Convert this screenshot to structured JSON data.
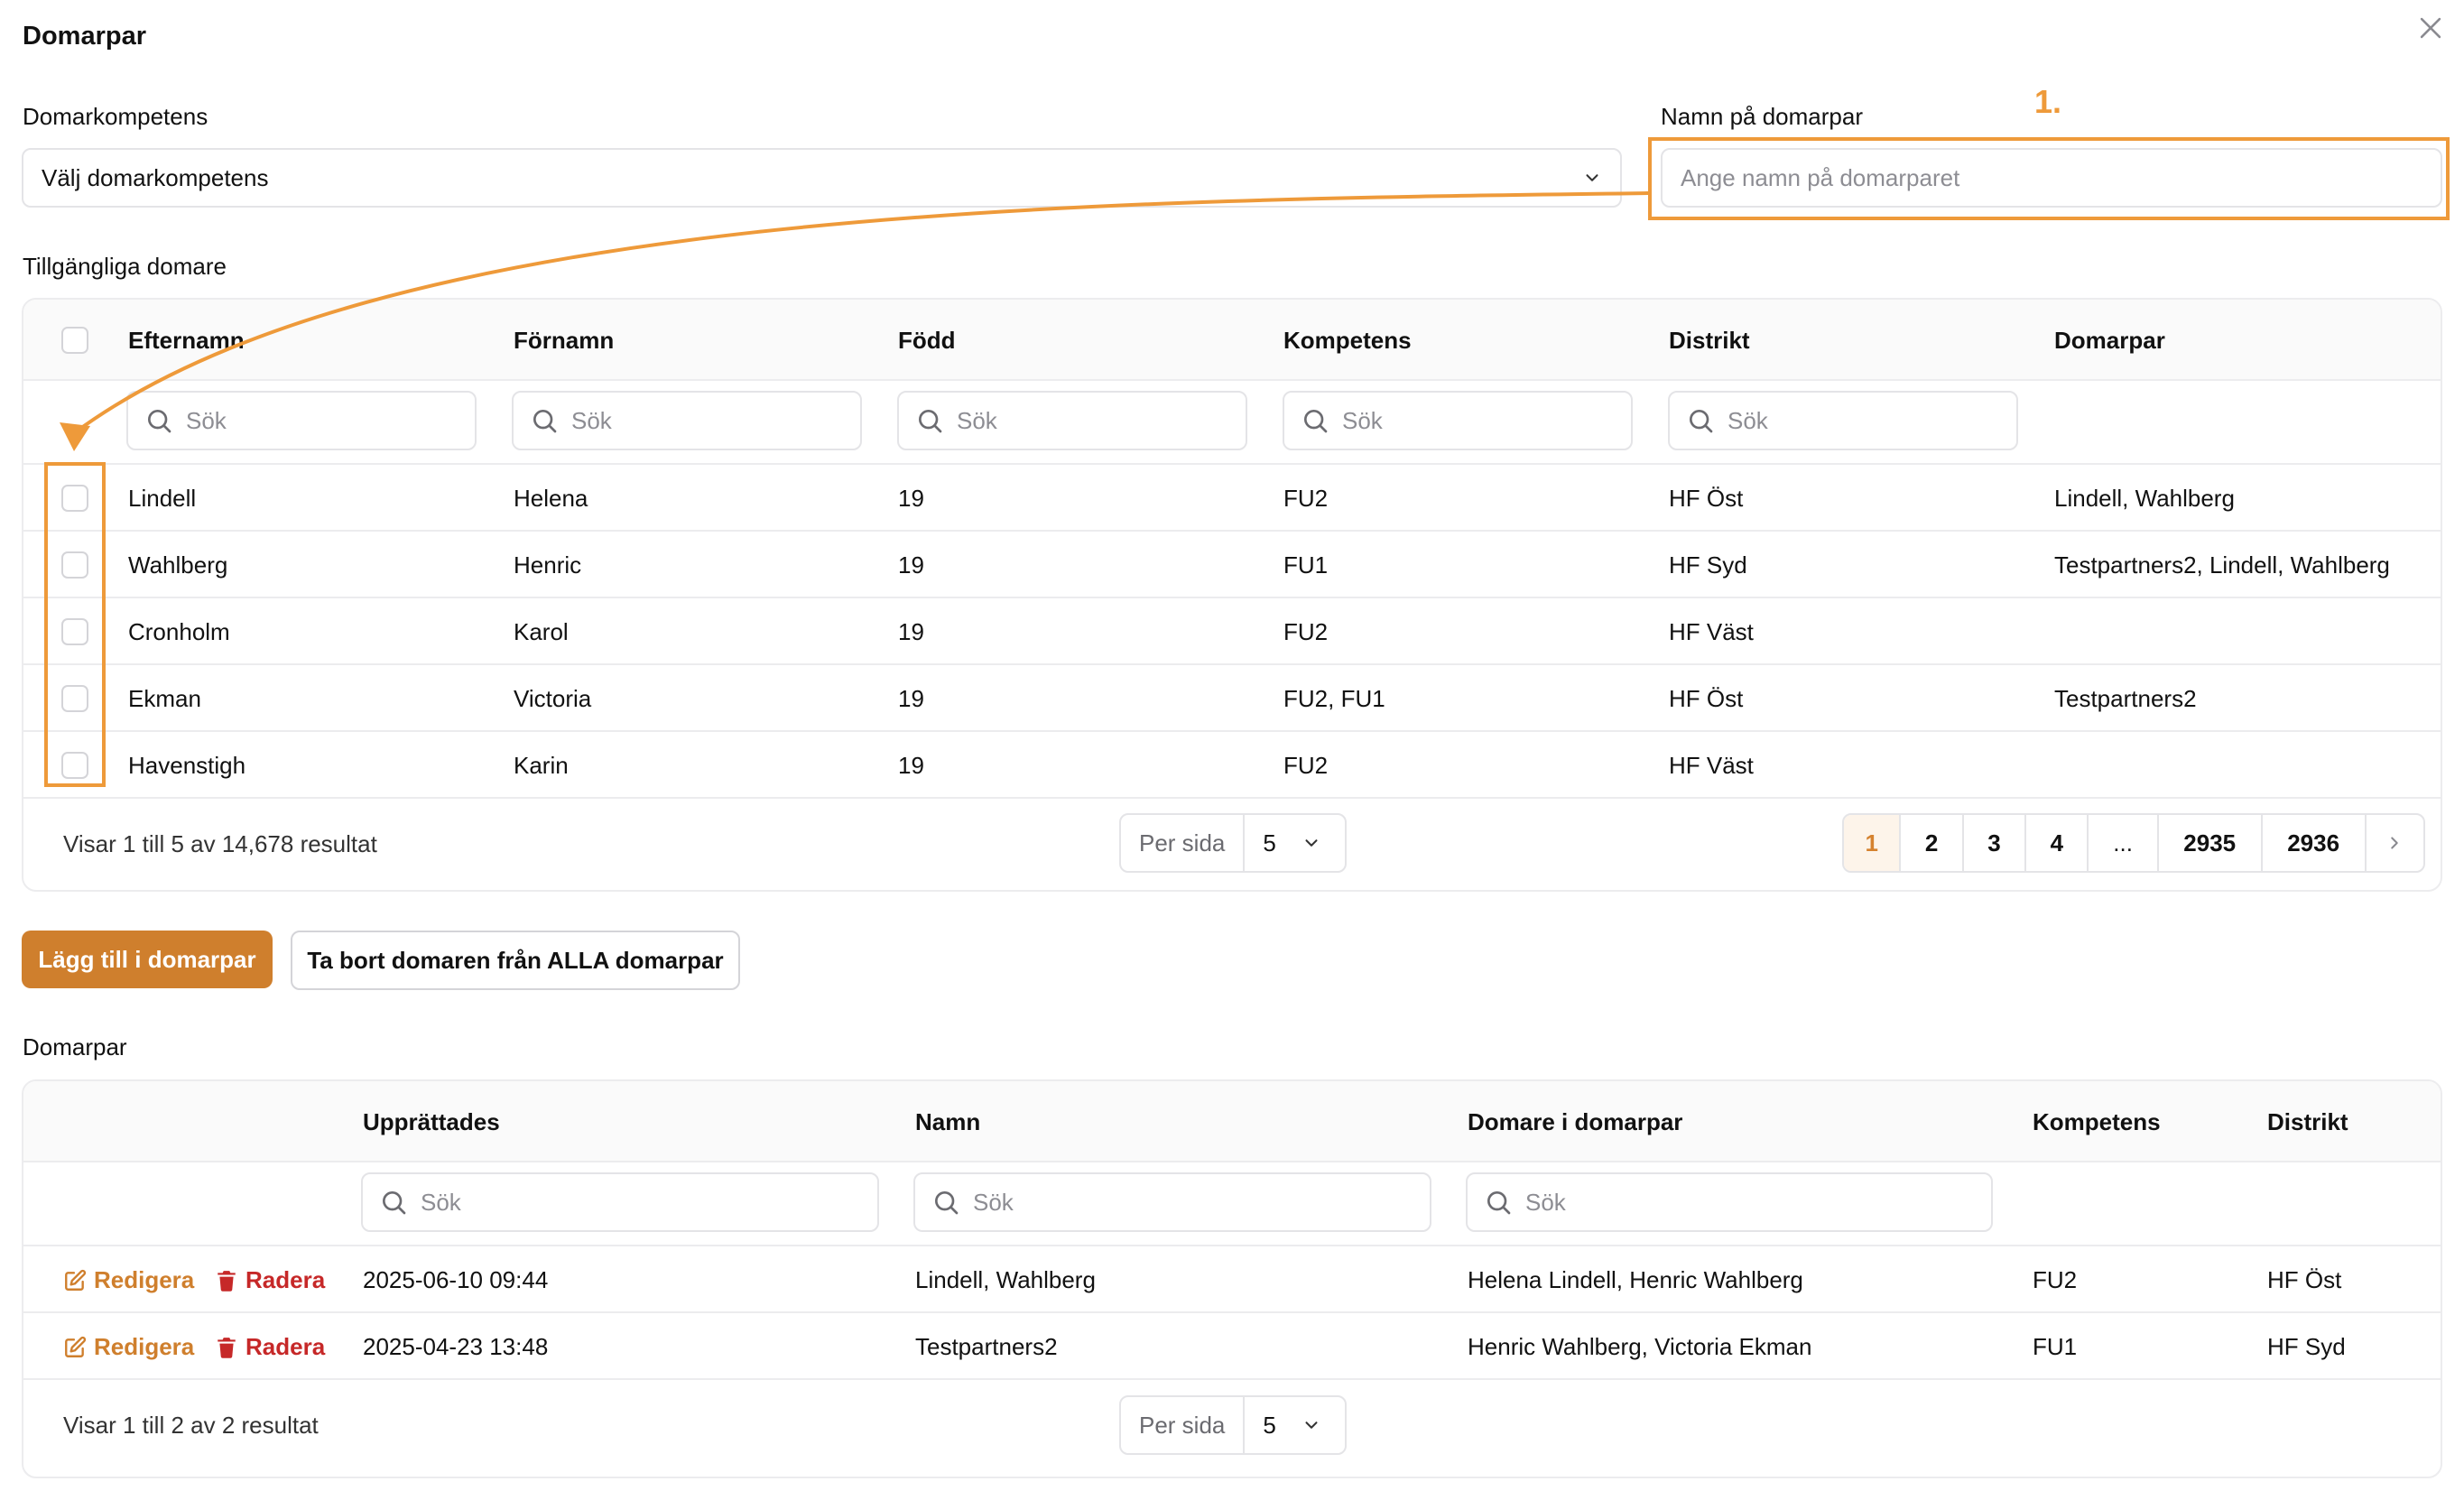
{
  "dialog": {
    "title": "Domarpar"
  },
  "form": {
    "competence_label": "Domarkompetens",
    "competence_value": "Välj domarkompetens",
    "name_label": "Namn på domarpar",
    "name_placeholder": "Ange namn på domarparet"
  },
  "available": {
    "title": "Tillgängliga domare",
    "columns": [
      "Efternamn",
      "Förnamn",
      "Född",
      "Kompetens",
      "Distrikt",
      "Domarpar"
    ],
    "search_placeholder": "Sök",
    "rows": [
      [
        "Lindell",
        "Helena",
        "19",
        "FU2",
        "HF Öst",
        "Lindell, Wahlberg"
      ],
      [
        "Wahlberg",
        "Henric",
        "19",
        "FU1",
        "HF Syd",
        "Testpartners2, Lindell, Wahlberg"
      ],
      [
        "Cronholm",
        "Karol",
        "19",
        "FU2",
        "HF Väst",
        ""
      ],
      [
        "Ekman",
        "Victoria",
        "19",
        "FU2, FU1",
        "HF Öst",
        "Testpartners2"
      ],
      [
        "Havenstigh",
        "Karin",
        "19",
        "FU2",
        "HF Väst",
        ""
      ]
    ],
    "footer_text": "Visar 1 till 5 av 14,678 resultat",
    "per_page_label": "Per sida",
    "per_page_value": "5",
    "pages": [
      "1",
      "2",
      "3",
      "4",
      "...",
      "2935",
      "2936"
    ]
  },
  "buttons": {
    "add": "Lägg till i domarpar",
    "remove_all": "Ta bort domaren från ALLA domarpar"
  },
  "pairs": {
    "title": "Domarpar",
    "columns": [
      "Upprättades",
      "Namn",
      "Domare i domarpar",
      "Kompetens",
      "Distrikt"
    ],
    "search_placeholder": "Sök",
    "edit_label": "Redigera",
    "delete_label": "Radera",
    "rows": [
      [
        "2025-06-10 09:44",
        "Lindell, Wahlberg",
        "Helena Lindell, Henric Wahlberg",
        "FU2",
        "HF Öst"
      ],
      [
        "2025-04-23 13:48",
        "Testpartners2",
        "Henric Wahlberg, Victoria Ekman",
        "FU1",
        "HF Syd"
      ]
    ],
    "footer_text": "Visar 1 till 2 av 2 resultat",
    "per_page_label": "Per sida",
    "per_page_value": "5"
  },
  "annotation": {
    "step": "1."
  },
  "colors": {
    "accent": "#cf7f2d",
    "annotation": "#ee9a3a",
    "danger": "#c62828"
  },
  "icons": {
    "close": "close-icon",
    "chevron": "chevron-down-icon",
    "search": "search-icon",
    "edit": "edit-icon",
    "delete": "trash-icon",
    "next": "chevron-right-icon"
  }
}
